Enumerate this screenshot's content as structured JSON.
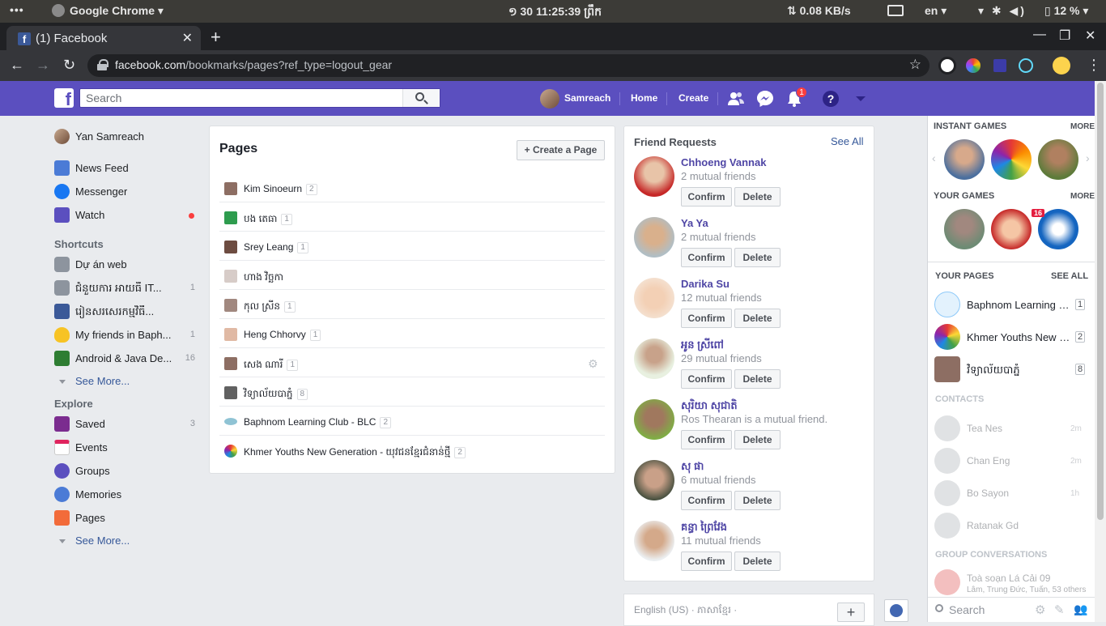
{
  "os": {
    "dots": "•••",
    "app_name": "Google Chrome",
    "clock": "១ 30  11:25:39 ព្រឹក",
    "net_speed": "⇅ 0.08 KB/s",
    "lang": "en",
    "battery": "12 %"
  },
  "browser": {
    "tab_title": "(1) Facebook",
    "url_host": "facebook.com",
    "url_path": "/bookmarks/pages?ref_type=logout_gear"
  },
  "fb": {
    "logo": "f",
    "search_placeholder": "Search",
    "user_name": "Samreach",
    "nav_home": "Home",
    "nav_create": "Create",
    "notif_count": "1"
  },
  "leftnav": {
    "profile_name": "Yan Samreach",
    "main_items": [
      {
        "label": "News Feed",
        "color": "#4b7bd6"
      },
      {
        "label": "Messenger",
        "color": "#1877f2"
      },
      {
        "label": "Watch",
        "color": "#5b4fbf"
      }
    ],
    "shortcuts_heading": "Shortcuts",
    "shortcuts": [
      {
        "label": "Dự án web",
        "count": ""
      },
      {
        "label": "ជំនួយការ អាយធី IT...",
        "count": "1"
      },
      {
        "label": "រៀនសរសេរកម្មវិធី...",
        "count": ""
      },
      {
        "label": "My friends in Baph...",
        "count": "1"
      },
      {
        "label": "Android & Java De...",
        "count": "16"
      }
    ],
    "see_more": "See More...",
    "explore_heading": "Explore",
    "explore": [
      {
        "label": "Saved",
        "count": "3"
      },
      {
        "label": "Events",
        "count": ""
      },
      {
        "label": "Groups",
        "count": ""
      },
      {
        "label": "Memories",
        "count": ""
      },
      {
        "label": "Pages",
        "count": ""
      }
    ],
    "see_more_2": "See More..."
  },
  "pages_panel": {
    "title": "Pages",
    "create_button": "+ Create a Page",
    "rows": [
      {
        "name": "Kim Sinoeurn",
        "count": "2"
      },
      {
        "name": "បង តេធា",
        "count": "1"
      },
      {
        "name": "Srey Leang",
        "count": "1"
      },
      {
        "name": "ហាង វិច្ឆកា",
        "count": ""
      },
      {
        "name": "កុល ស្រីន",
        "count": "1"
      },
      {
        "name": "Heng Chhorvy",
        "count": "1"
      },
      {
        "name": "សេង ណារី",
        "count": "1"
      },
      {
        "name": "វិទ្យាល័យបាភ្នំ",
        "count": "8"
      },
      {
        "name": "Baphnom Learning Club - BLC",
        "count": "2"
      },
      {
        "name": "Khmer Youths New Generation - យុវជនខ្មែរជំនាន់ថ្មី",
        "count": "2"
      }
    ]
  },
  "friend_requests": {
    "heading": "Friend Requests",
    "see_all": "See All",
    "confirm_label": "Confirm",
    "delete_label": "Delete",
    "items": [
      {
        "name": "Chhoeng Vannak",
        "mutual": "2 mutual friends"
      },
      {
        "name": "Ya Ya",
        "mutual": "2 mutual friends"
      },
      {
        "name": "Darika Su",
        "mutual": "12 mutual friends"
      },
      {
        "name": "អូន ស្រីពៅ",
        "mutual": "29 mutual friends"
      },
      {
        "name": "សុរិយា សុជាតិ",
        "mutual": "Ros Thearan is a mutual friend."
      },
      {
        "name": "សុ ផា",
        "mutual": "6 mutual friends"
      },
      {
        "name": "គន្ធា ព្រៃវែង",
        "mutual": "11 mutual friends"
      }
    ]
  },
  "language_box": {
    "langs": "English (US) · ភាសាខ្មែរ ·",
    "plus": "+"
  },
  "right_sidebar": {
    "instant_games": "INSTANT GAMES",
    "more_1": "MORE",
    "your_games": "YOUR GAMES",
    "more_2": "MORE",
    "game_badge": "16",
    "your_pages": "YOUR PAGES",
    "see_all": "SEE ALL",
    "pages": [
      {
        "name": "Baphnom Learning Cl...",
        "count": "1"
      },
      {
        "name": "Khmer Youths New G...",
        "count": "2"
      },
      {
        "name": "វិទ្យាល័យបាភ្នំ",
        "count": "8"
      }
    ],
    "contacts_heading": "CONTACTS",
    "contacts": [
      {
        "name": "Tea Nes",
        "time": "2m"
      },
      {
        "name": "Chan Eng",
        "time": "2m"
      },
      {
        "name": "Bo Sayon",
        "time": "1h"
      },
      {
        "name": "Ratanak Gd",
        "time": ""
      }
    ],
    "group_heading": "GROUP CONVERSATIONS",
    "group_name": "Toà soạn Lá Cải 09",
    "group_members": "Lâm, Trung Đức, Tuấn, 53 others",
    "search_placeholder": "Search"
  }
}
